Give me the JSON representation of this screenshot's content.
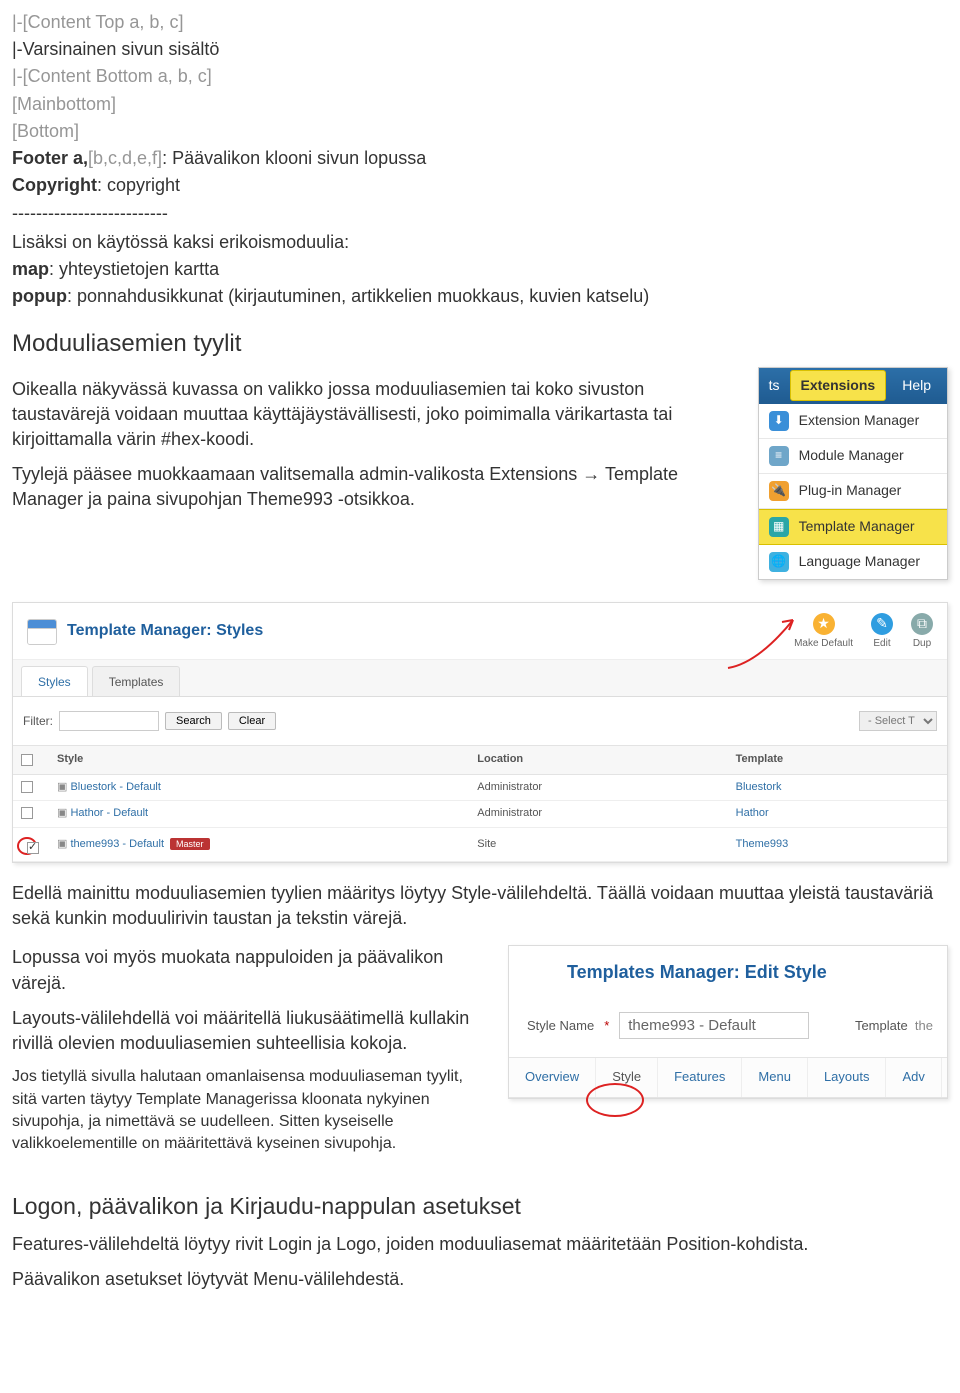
{
  "top_block": {
    "l1": "|-[Content Top a, b, c]",
    "l2": "|-Varsinainen sivun sisältö",
    "l3": "|-[Content Bottom a, b, c]",
    "l4": "[Mainbottom]",
    "l5": "[Bottom]",
    "l6a": "Footer a,",
    "l6b": "[b,c,d,e,f]",
    "l6c": ": Päävalikon klooni sivun lopussa",
    "l7a": "Copyright",
    "l7b": ": copyright",
    "sep": "--------------------------",
    "l8": "Lisäksi on käytössä kaksi erikoismoduulia:",
    "l9a": "map",
    "l9b": ": yhteystietojen kartta",
    "l10a": "popup",
    "l10b": ": ponnahdusikkunat (kirjautuminen, artikkelien muokkaus, kuvien katselu)"
  },
  "h_styles": "Moduuliasemien tyylit",
  "styles_para1": "Oikealla näkyvässä kuvassa on valikko jossa moduuliasemien tai koko sivuston taustavärejä voidaan muuttaa käyttäjäystävällisesti, joko poimimalla värikartasta tai kirjoittamalla värin #hex-koodi.",
  "styles_para2": "Tyylejä pääsee muokkaamaan valitsemalla admin-valikosta Extensions → Template Manager ja paina sivupohjan Theme993 -otsikkoa.",
  "ext": {
    "ts": "ts",
    "extensions": "Extensions",
    "help": "Help",
    "items": [
      "Extension Manager",
      "Module Manager",
      "Plug-in Manager",
      "Template Manager",
      "Language Manager"
    ]
  },
  "tm": {
    "title": "Template Manager: Styles",
    "actions": {
      "default": "Make Default",
      "edit": "Edit",
      "dup": "Dup"
    },
    "tabs": {
      "styles": "Styles",
      "templates": "Templates"
    },
    "filter_label": "Filter:",
    "search": "Search",
    "clear": "Clear",
    "select": "- Select T",
    "cols": {
      "style": "Style",
      "location": "Location",
      "template": "Template"
    },
    "rows": [
      {
        "style": "Bluestork - Default",
        "loc": "Administrator",
        "tpl": "Bluestork"
      },
      {
        "style": "Hathor - Default",
        "loc": "Administrator",
        "tpl": "Hathor"
      },
      {
        "style": "theme993 - Default",
        "loc": "Site",
        "tpl": "Theme993",
        "master": "Master"
      }
    ]
  },
  "mid_para1": "Edellä mainittu moduuliasemien tyylien määritys löytyy Style-välilehdeltä. Täällä voidaan muuttaa yleistä taustaväriä sekä kunkin moduulirivin taustan ja tekstin värejä.",
  "mid_para2": "Lopussa voi myös muokata nappuloiden ja päävalikon värejä.",
  "mid_para3": "Layouts-välilehdellä voi määritellä liukusäätimellä kullakin rivillä olevien moduuliasemien suhteellisia kokoja.",
  "mid_para4": "Jos tietyllä sivulla halutaan omanlaisensa moduuliaseman tyylit, sitä varten täytyy Template Managerissa kloonata nykyinen sivupohja, ja nimettävä se uudelleen. Sitten kyseiselle valikkoelementille on määritettävä kyseinen sivupohja.",
  "es": {
    "title": "Templates Manager: Edit Style",
    "name_label": "Style Name",
    "req": "*",
    "name_value": "theme993 - Default",
    "template_label": "Template",
    "template_value": "the",
    "tabs": [
      "Overview",
      "Style",
      "Features",
      "Menu",
      "Layouts",
      "Adv"
    ]
  },
  "h_logon": "Logon, päävalikon ja Kirjaudu-nappulan asetukset",
  "logon_p1": "Features-välilehdeltä löytyy rivit Login ja Logo, joiden moduuliasemat määritetään Position-kohdista.",
  "logon_p2": "Päävalikon asetukset löytyvät Menu-välilehdestä."
}
